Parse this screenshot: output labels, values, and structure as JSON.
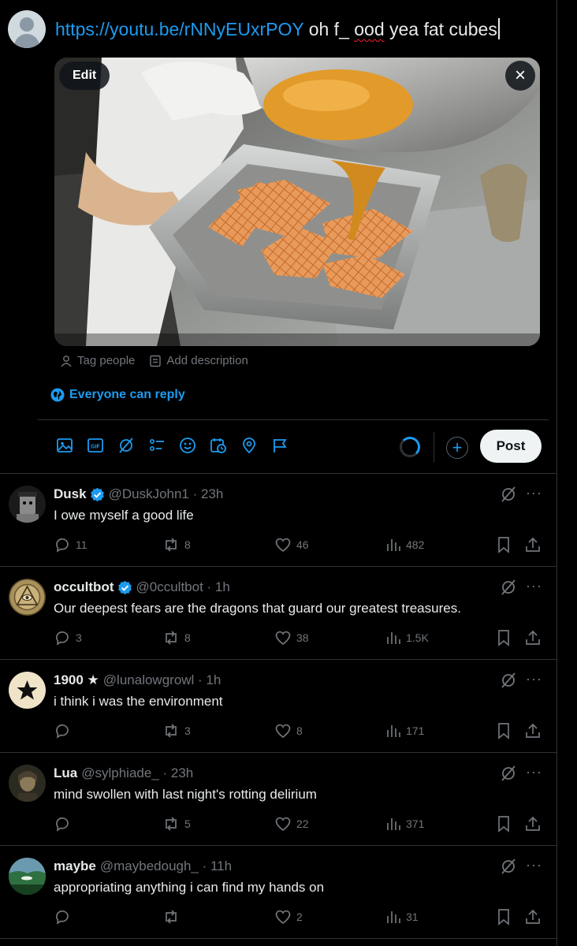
{
  "composer": {
    "link_text": "https://youtu.be/rNNyEUxrPOY",
    "text_before_typo": "oh f_ ",
    "typo_word": "ood",
    "text_after_typo": " yea fat cubes",
    "edit_label": "Edit",
    "close_label": "×",
    "tag_people": "Tag people",
    "add_description": "Add description",
    "reply_setting": "Everyone can reply",
    "post_label": "Post",
    "add_label": "+",
    "toolbar_icons": [
      "image-icon",
      "gif-icon",
      "grok-icon",
      "poll-icon",
      "emoji-icon",
      "schedule-icon",
      "location-icon",
      "flag-icon"
    ]
  },
  "tweets": [
    {
      "name": "Dusk",
      "verified": true,
      "handle": "@DuskJohn1 · 23h",
      "text": "I owe myself a good life",
      "replies": "11",
      "reposts": "8",
      "likes": "46",
      "views": "482"
    },
    {
      "name": "occultbot",
      "verified": true,
      "handle": "@0ccultbot · 1h",
      "text": "Our deepest fears are the dragons that guard our greatest treasures.",
      "replies": "3",
      "reposts": "8",
      "likes": "38",
      "views": "1.5K"
    },
    {
      "name": "1900 ★",
      "verified": false,
      "handle": "@lunalowgrowl · 1h",
      "text": "i think i was the environment",
      "replies": "",
      "reposts": "3",
      "likes": "8",
      "views": "171"
    },
    {
      "name": "Lua",
      "verified": false,
      "handle": "@sylphiade_ · 23h",
      "text": "mind swollen with last night's rotting delirium",
      "replies": "",
      "reposts": "5",
      "likes": "22",
      "views": "371"
    },
    {
      "name": "maybe",
      "verified": false,
      "handle": "@maybedough_ · 11h",
      "text": "appropriating anything i can find my hands on",
      "replies": "",
      "reposts": "",
      "likes": "2",
      "views": "31"
    }
  ],
  "colors": {
    "accent": "#1d9bf0",
    "muted": "#71767b",
    "divider": "#2f3336",
    "verified": "#1d9bf0"
  }
}
